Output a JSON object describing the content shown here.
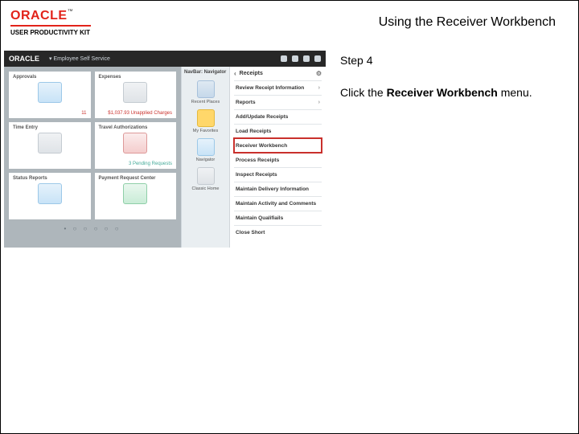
{
  "banner": {
    "brand_word": "ORACLE",
    "brand_tm": "™",
    "upk": "USER PRODUCTIVITY KIT",
    "title": "Using the Receiver Workbench"
  },
  "instructions": {
    "step_label": "Step 4",
    "step_pre": "Click the ",
    "step_bold": "Receiver Workbench",
    "step_post": " menu."
  },
  "screenshot": {
    "topbar": {
      "brand": "ORACLE",
      "breadcrumb": "Employee Self Service"
    },
    "tiles": [
      {
        "label": "Approvals",
        "footer": "11",
        "footer_class": "",
        "icon": "i-blue"
      },
      {
        "label": "Expenses",
        "footer": "$1,037.93 Unapplied Charges",
        "footer_class": "",
        "icon": "i-gray"
      },
      {
        "label": "Time Entry",
        "footer": "",
        "footer_class": "gray",
        "icon": "i-gray"
      },
      {
        "label": "Travel Authorizations",
        "footer": "3 Pending Requests",
        "footer_class": "green",
        "icon": "i-red"
      },
      {
        "label": "Status Reports",
        "footer": "",
        "footer_class": "",
        "icon": "i-blue"
      },
      {
        "label": "Payment Request Center",
        "footer": "",
        "footer_class": "",
        "icon": "i-green"
      }
    ],
    "navcol": {
      "title": "NavBar: Navigator",
      "items": [
        {
          "label": "Recent Places",
          "icon": "i-nav"
        },
        {
          "label": "My Favorites",
          "icon": "i-star"
        },
        {
          "label": "Navigator",
          "icon": "i-blue"
        },
        {
          "label": "Classic Home",
          "icon": "i-gray"
        }
      ]
    },
    "menu": {
      "heading": "Receipts",
      "items": [
        {
          "label": "Review Receipt Information",
          "chevron": true
        },
        {
          "label": "Reports",
          "chevron": true
        },
        {
          "label": "Add/Update Receipts",
          "chevron": false
        },
        {
          "label": "Load Receipts",
          "chevron": false
        },
        {
          "label": "Receiver Workbench",
          "chevron": false,
          "highlight": true
        },
        {
          "label": "Process Receipts",
          "chevron": false
        },
        {
          "label": "Inspect Receipts",
          "chevron": false
        },
        {
          "label": "Maintain Delivery Information",
          "chevron": false
        },
        {
          "label": "Maintain Activity and Comments",
          "chevron": false
        },
        {
          "label": "Maintain Qualifiails",
          "chevron": false
        },
        {
          "label": "Close Short",
          "chevron": false
        }
      ]
    }
  }
}
